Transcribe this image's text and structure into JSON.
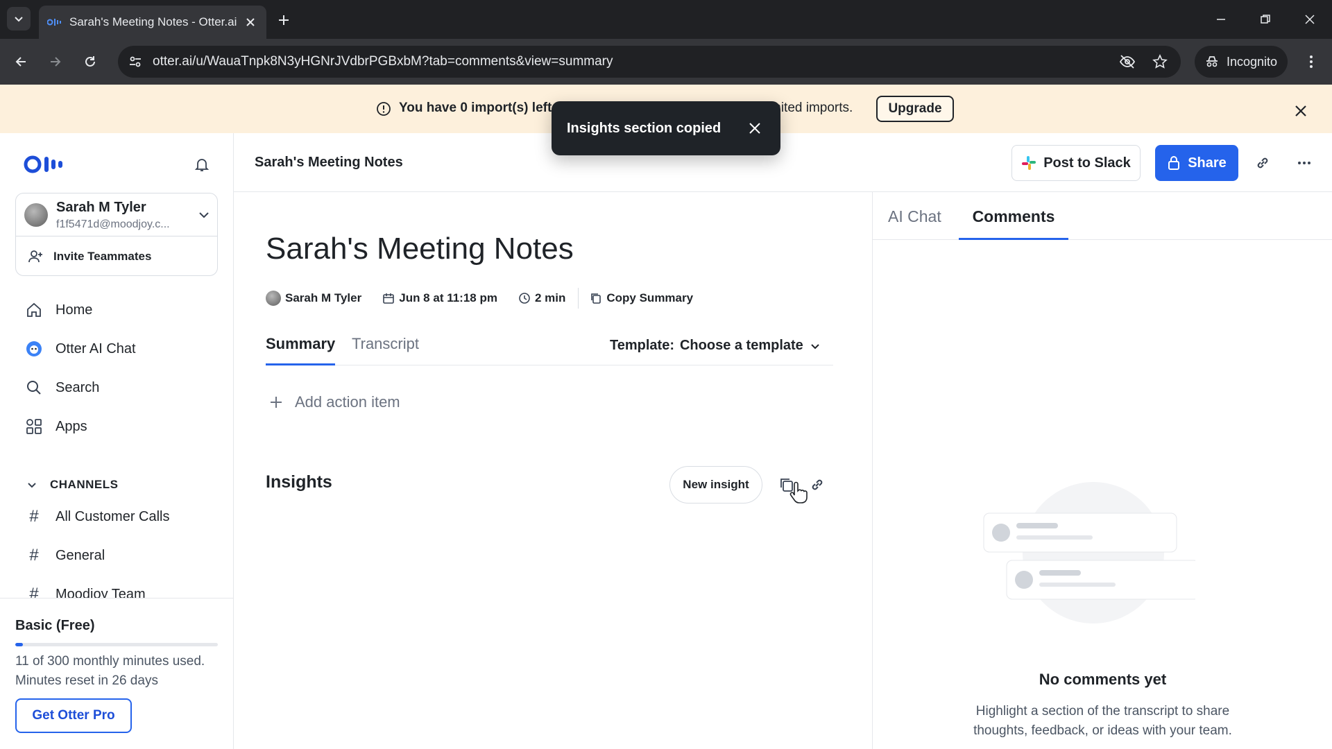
{
  "browser": {
    "tab_title": "Sarah's Meeting Notes - Otter.ai",
    "url": "otter.ai/u/WauaTnpk8N3yHGNrJVdbrPGBxbM?tab=comments&view=summary",
    "incognito_label": "Incognito"
  },
  "banner": {
    "text_left": "You have 0 import(s) left",
    "text_right": "mited imports.",
    "upgrade_label": "Upgrade"
  },
  "toast": {
    "message": "Insights section copied"
  },
  "sidebar": {
    "account": {
      "name": "Sarah M Tyler",
      "email": "f1f5471d@moodjoy.c..."
    },
    "invite_label": "Invite Teammates",
    "nav": [
      {
        "label": "Home",
        "icon": "home-icon"
      },
      {
        "label": "Otter AI Chat",
        "icon": "otter-ai-chat-icon"
      },
      {
        "label": "Search",
        "icon": "search-icon"
      },
      {
        "label": "Apps",
        "icon": "apps-icon"
      }
    ],
    "channels_header": "CHANNELS",
    "channels": [
      "All Customer Calls",
      "General",
      "Moodjoy Team"
    ],
    "plan": {
      "name": "Basic (Free)",
      "usage_text": "11 of 300 monthly minutes used.",
      "reset_text": "Minutes reset in 26 days",
      "usage_fraction": 0.037,
      "cta_label": "Get Otter Pro"
    }
  },
  "header": {
    "title": "Sarah's Meeting Notes",
    "post_to_slack_label": "Post to Slack",
    "share_label": "Share"
  },
  "main": {
    "title": "Sarah's Meeting Notes",
    "meta": {
      "owner": "Sarah M Tyler",
      "date": "Jun 8 at 11:18 pm",
      "duration": "2 min",
      "copy_summary_label": "Copy Summary"
    },
    "tabs": {
      "summary": "Summary",
      "transcript": "Transcript"
    },
    "template": {
      "label": "Template:",
      "value": "Choose a template"
    },
    "add_action_label": "Add action item",
    "insights": {
      "title": "Insights",
      "new_insight_label": "New insight"
    }
  },
  "right_panel": {
    "tabs": {
      "ai_chat": "AI Chat",
      "comments": "Comments"
    },
    "empty_title": "No comments yet",
    "empty_subtitle": "Highlight a section of the transcript to share thoughts, feedback, or ideas with your team."
  },
  "colors": {
    "accent": "#2563eb",
    "banner_bg": "#fdf0dc",
    "toast_bg": "#1f2328"
  }
}
